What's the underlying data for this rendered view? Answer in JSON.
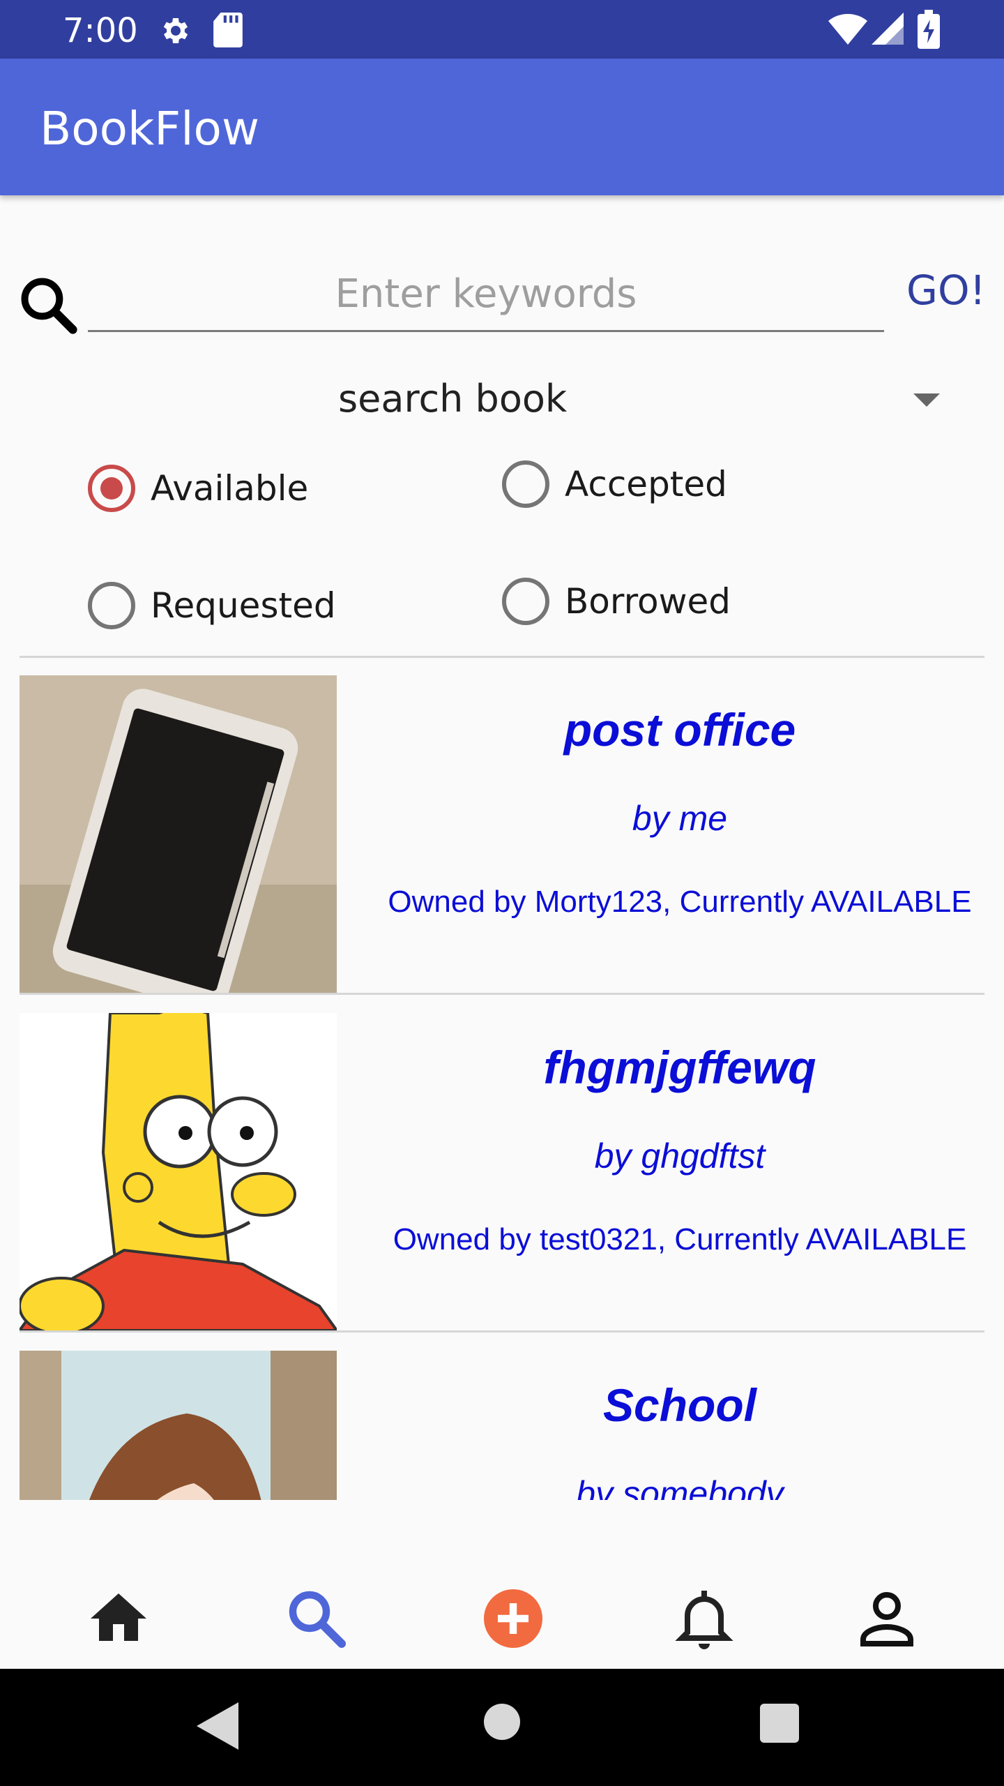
{
  "status_bar": {
    "time": "7:00"
  },
  "app_bar": {
    "title": "BookFlow"
  },
  "search": {
    "placeholder": "Enter keywords",
    "go_label": "GO!"
  },
  "spinner": {
    "selected": "search book"
  },
  "filters": [
    {
      "label": "Available",
      "checked": true
    },
    {
      "label": "Accepted",
      "checked": false
    },
    {
      "label": "Requested",
      "checked": false
    },
    {
      "label": "Borrowed",
      "checked": false
    }
  ],
  "books": [
    {
      "title": "post office",
      "author": "by me",
      "status": "Owned by Morty123, Currently AVAILABLE"
    },
    {
      "title": "fhgmjgffewq",
      "author": "by ghgdftst",
      "status": "Owned by test0321, Currently AVAILABLE"
    },
    {
      "title": "School",
      "author": "by somebody",
      "status": ""
    }
  ],
  "bottom_nav": {
    "items": [
      "home-icon",
      "search-icon",
      "add-icon",
      "notifications-icon",
      "profile-icon"
    ],
    "active": "search-icon"
  },
  "colors": {
    "status_bar": "#303f9f",
    "app_bar": "#4f66d9",
    "accent": "#c94a4a",
    "book_text": "#0b0ed6",
    "add_button": "#f26a3f"
  }
}
